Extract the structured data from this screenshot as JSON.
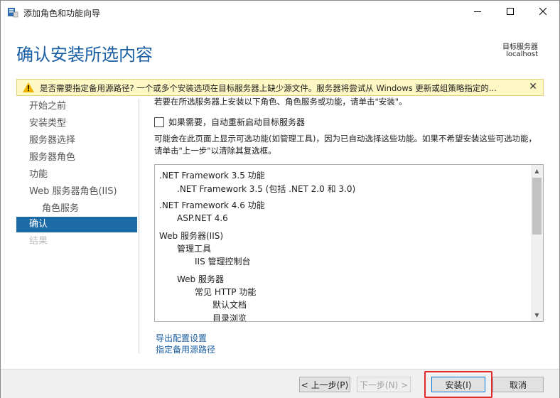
{
  "window": {
    "title": "添加角色和功能向导"
  },
  "header": {
    "title": "确认安装所选内容",
    "target_label": "目标服务器",
    "target_value": "localhost"
  },
  "warning": {
    "text": "是否需要指定备用源路径? 一个或多个安装选项在目标服务器上缺少源文件。服务器将尝试从 Windows 更新或组策略指定的..."
  },
  "nav": {
    "items": [
      {
        "label": "开始之前"
      },
      {
        "label": "安装类型"
      },
      {
        "label": "服务器选择"
      },
      {
        "label": "服务器角色"
      },
      {
        "label": "功能"
      },
      {
        "label": "Web 服务器角色(IIS)"
      },
      {
        "label": "角色服务"
      },
      {
        "label": "确认"
      },
      {
        "label": "结果"
      }
    ]
  },
  "main": {
    "intro": "若要在所选服务器上安装以下角色、角色服务或功能，请单击\"安装\"。",
    "restart_label": "如果需要，自动重新启动目标服务器",
    "restart_checked": false,
    "info": "可能会在此页面上显示可选功能(如管理工具)，因为已自动选择这些功能。如果不希望安装这些可选功能，请单击\"上一步\"以清除其复选框。",
    "list": [
      ".NET Framework 3.5 功能",
      ".NET Framework 3.5 (包括 .NET 2.0 和 3.0)",
      ".NET Framework 4.6 功能",
      "ASP.NET 4.6",
      "Web 服务器(IIS)",
      "管理工具",
      "IIS 管理控制台",
      "Web 服务器",
      "常见 HTTP 功能",
      "默认文档",
      "目录浏览"
    ],
    "links": {
      "export": "导出配置设置",
      "source": "指定备用源路径"
    }
  },
  "footer": {
    "prev": "< 上一步(P)",
    "next": "下一步(N) >",
    "install": "安装(I)",
    "cancel": "取消"
  },
  "colors": {
    "accent": "#1c6aa6",
    "title": "#1a5fa3",
    "warning_bg": "#fdf8c4",
    "highlight": "#e02c2c"
  }
}
